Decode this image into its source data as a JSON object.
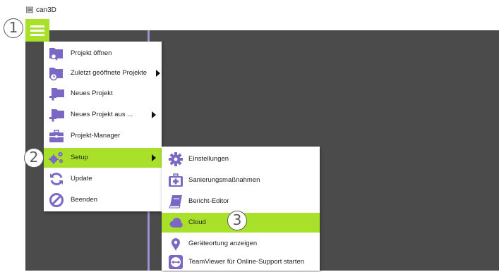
{
  "window": {
    "title": "can3D"
  },
  "callouts": [
    "1",
    "2",
    "3"
  ],
  "main_menu": {
    "items": [
      {
        "label": "Projekt öffnen",
        "icon": "folder-search-icon"
      },
      {
        "label": "Zuletzt geöffnete Projekte",
        "icon": "folder-recent-icon"
      },
      {
        "label": "Neues Projekt",
        "icon": "folder-add-icon"
      },
      {
        "label": "Neues Projekt aus ...",
        "icon": "folder-template-icon"
      },
      {
        "label": "Projekt-Manager",
        "icon": "briefcase-icon"
      },
      {
        "label": "Setup",
        "icon": "gears-icon"
      },
      {
        "label": "Update",
        "icon": "refresh-icon"
      },
      {
        "label": "Beenden",
        "icon": "no-entry-icon"
      }
    ]
  },
  "setup_submenu": {
    "items": [
      {
        "label": "Einstellungen",
        "icon": "gear-icon"
      },
      {
        "label": "Sanierungsmaßnahmen",
        "icon": "medical-kit-icon"
      },
      {
        "label": "Bericht-Editor",
        "icon": "book-icon"
      },
      {
        "label": "Cloud",
        "icon": "cloud-icon"
      },
      {
        "label": "Geräteortung anzeigen",
        "icon": "location-pin-icon"
      },
      {
        "label": "TeamViewer für Online-Support starten",
        "icon": "teamviewer-icon"
      }
    ]
  },
  "colors": {
    "accent": "#a8e02a",
    "icon": "#7b68c4",
    "workspace": "#4b4b4b",
    "divider": "#9d8fd0"
  }
}
